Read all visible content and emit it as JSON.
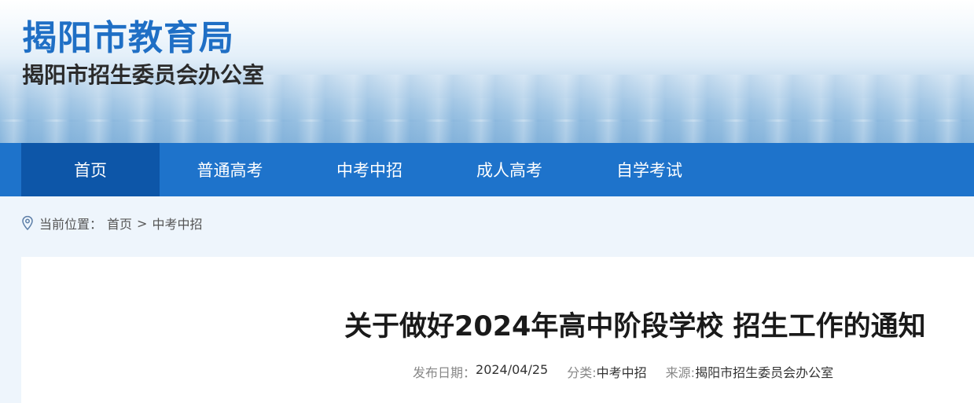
{
  "header": {
    "title": "揭阳市教育局",
    "subtitle": "揭阳市招生委员会办公室"
  },
  "nav": {
    "items": [
      {
        "label": "首页",
        "active": true
      },
      {
        "label": "普通高考",
        "active": false
      },
      {
        "label": "中考中招",
        "active": false
      },
      {
        "label": "成人高考",
        "active": false
      },
      {
        "label": "自学考试",
        "active": false
      }
    ]
  },
  "breadcrumb": {
    "icon": "location-pin-icon",
    "prefix": "当前位置：",
    "home": "首页",
    "separator": ">",
    "current": "中考中招"
  },
  "article": {
    "title": "关于做好2024年高中阶段学校 招生工作的通知",
    "date_label": "发布日期：",
    "date": "2024/04/25",
    "category_label": "分类:",
    "category": "中考中招",
    "source_label": "来源:",
    "source": "揭阳市招生委员会办公室"
  },
  "colors": {
    "brand_blue": "#1f6fc5",
    "nav_bg": "#1e73cb",
    "nav_active": "#0d56a8",
    "page_bg": "#eef5fc"
  }
}
